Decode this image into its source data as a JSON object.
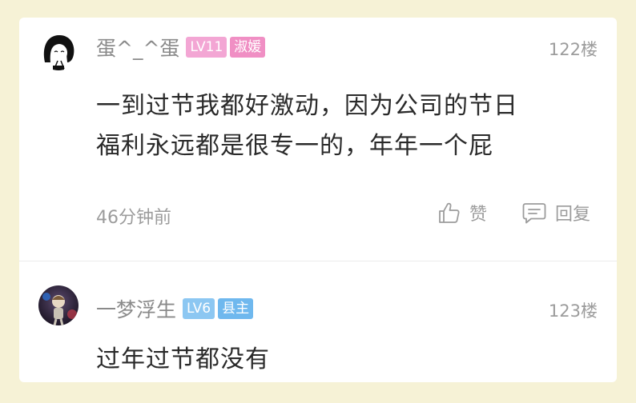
{
  "comments": [
    {
      "username": "蛋^_^蛋",
      "level": "LV11",
      "title": "淑媛",
      "floor": "122楼",
      "content_line1": "一到过节我都好激动，因为公司的节日",
      "content_line2": "福利永远都是很专一的，年年一个屁",
      "time": "46分钟前",
      "like_label": "赞",
      "reply_label": "回复",
      "level_color": "#f3a6d4",
      "title_color": "#f08fc4"
    },
    {
      "username": "一梦浮生",
      "level": "LV6",
      "title": "县主",
      "floor": "123楼",
      "content_line1": "过年过节都没有",
      "level_color": "#8cc7f2",
      "title_color": "#6fb8ee"
    }
  ],
  "icons": {
    "like": "thumbs-up-icon",
    "reply": "comment-bubble-icon"
  }
}
